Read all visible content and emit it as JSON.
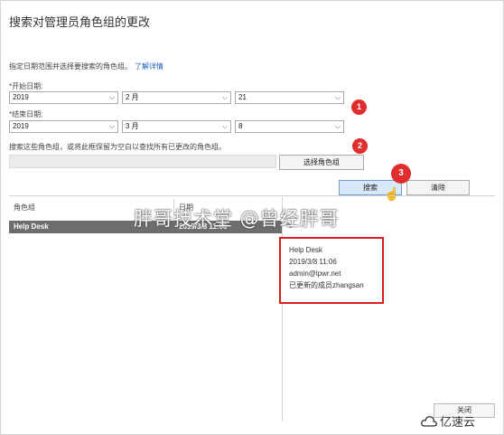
{
  "title": "搜索对管理员角色组的更改",
  "description": "指定日期范围并选择要搜索的角色组。",
  "learn_more": "了解详情",
  "start_date": {
    "label": "*开始日期:",
    "year": "2019",
    "month": "2 月",
    "day": "21"
  },
  "end_date": {
    "label": "*结束日期:",
    "year": "2019",
    "month": "3 月",
    "day": "8"
  },
  "role_group_hint": "搜索这些角色组，或将此框保留为空白以查找所有已更改的角色组。",
  "select_role_group_label": "选择角色组",
  "search_label": "搜索",
  "clear_label": "清除",
  "close_label": "关闭",
  "table": {
    "headers": [
      "角色组",
      "日期"
    ],
    "rows": [
      {
        "role_group": "Help Desk",
        "date": "2019/3/8 11:06"
      }
    ]
  },
  "details": {
    "name": "Help Desk",
    "date": "2019/3/8 11:06",
    "user": "admin@lpwr.net",
    "change": "已更新的成员zhangsan"
  },
  "badges": [
    "1",
    "2",
    "3"
  ],
  "watermark": "胖哥技术堂 @曾经胖哥",
  "logo": "亿速云",
  "colors": {
    "badge": "#e02d2d",
    "highlight_border": "#d91c1c",
    "selected_row": "#6e6e6e",
    "primary_button": "#d7e8f8"
  },
  "icons": {
    "chevron": "chevron-down-icon",
    "cursor": "hand-cursor-icon",
    "edit": "edit-icon",
    "logo": "cloud-logo-icon"
  }
}
